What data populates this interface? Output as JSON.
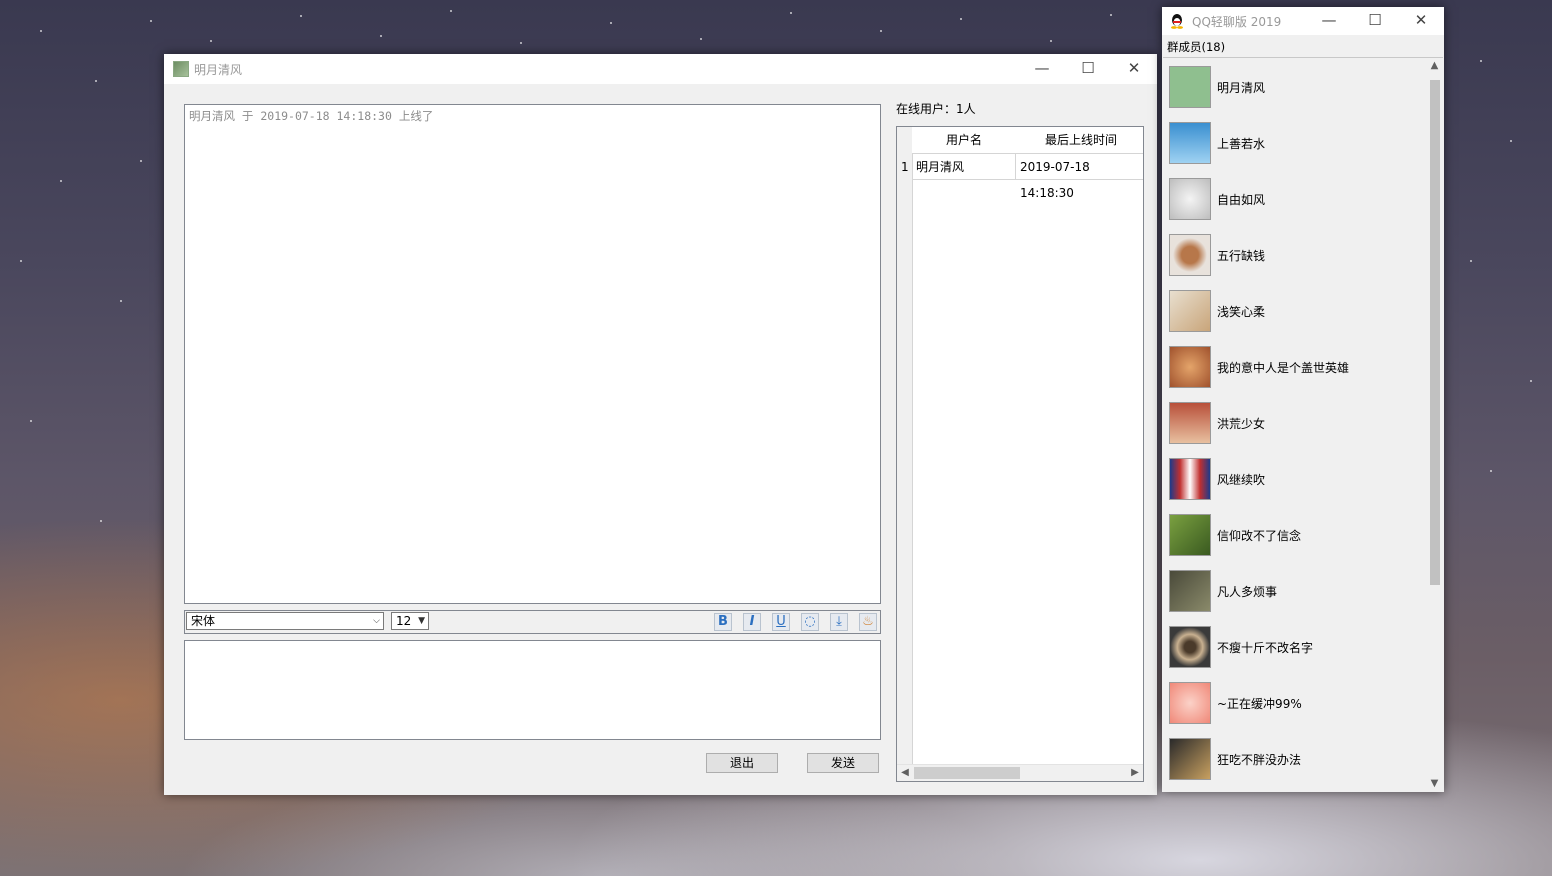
{
  "chat_window": {
    "title": "明月清风",
    "history": [
      "明月清风 于 2019-07-18 14:18:30 上线了"
    ],
    "font_select": "宋体",
    "size_select": "12",
    "format_buttons": [
      {
        "name": "bold-button",
        "glyph": "B"
      },
      {
        "name": "italic-button",
        "glyph": "I"
      },
      {
        "name": "underline-button",
        "glyph": "U"
      },
      {
        "name": "color-button",
        "glyph": "◌"
      },
      {
        "name": "upload-button",
        "glyph": "⤓"
      },
      {
        "name": "clear-button",
        "glyph": "♨"
      }
    ],
    "message_input": "",
    "exit_label": "退出",
    "send_label": "发送",
    "online_label": "在线用户：1人",
    "table": {
      "headers": [
        "用户名",
        "最后上线时间"
      ],
      "rows": [
        {
          "index": "1",
          "username": "明月清风",
          "last_online": "2019-07-18 14:18:30"
        }
      ]
    }
  },
  "members_window": {
    "title": "QQ轻聊版 2019",
    "count_label": "群成员(18)",
    "members": [
      {
        "name": "明月清风",
        "avatar_color": "#8fbf8f"
      },
      {
        "name": "上善若水",
        "avatar_color": "#4a9fd8"
      },
      {
        "name": "自由如风",
        "avatar_color": "#d9d9d9"
      },
      {
        "name": "五行缺钱",
        "avatar_color": "#b7774a"
      },
      {
        "name": "浅笑心柔",
        "avatar_color": "#c9a57a"
      },
      {
        "name": "我的意中人是个盖世英雄",
        "avatar_color": "#c0703a"
      },
      {
        "name": "洪荒少女",
        "avatar_color": "#b8503a"
      },
      {
        "name": "风继续吹",
        "avatar_color": "#a83a3a"
      },
      {
        "name": "信仰改不了信念",
        "avatar_color": "#6a8a3a"
      },
      {
        "name": "凡人多烦事",
        "avatar_color": "#5a5a4a"
      },
      {
        "name": "不瘦十斤不改名字",
        "avatar_color": "#7a6a4a"
      },
      {
        "name": "~正在缓冲99%",
        "avatar_color": "#f08878"
      },
      {
        "name": "狂吃不胖没办法",
        "avatar_color": "#6a5a3a"
      }
    ]
  }
}
